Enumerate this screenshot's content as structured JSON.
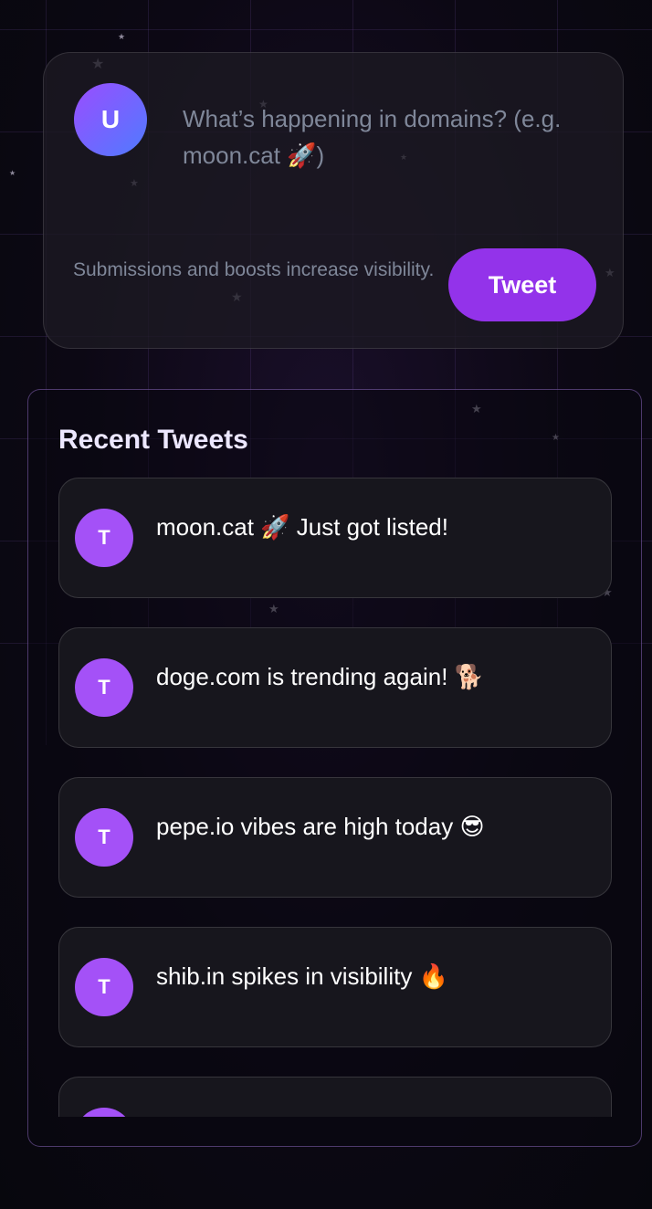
{
  "composer": {
    "avatar_initial": "U",
    "placeholder": "What’s happening in domains? (e.g. moon.cat 🚀)",
    "hint": "Submissions and boosts increase visibility.",
    "tweet_button_label": "Tweet"
  },
  "recent": {
    "title": "Recent Tweets",
    "tweets": [
      {
        "avatar_initial": "T",
        "text": "moon.cat 🚀 Just got listed!"
      },
      {
        "avatar_initial": "T",
        "text": "doge.com is trending again! 🐕"
      },
      {
        "avatar_initial": "T",
        "text": "pepe.io vibes are high today 😎"
      },
      {
        "avatar_initial": "T",
        "text": "shib.in spikes in visibility 🔥"
      },
      {
        "avatar_initial": "T",
        "text": ""
      }
    ]
  },
  "colors": {
    "accent": "#9333ea",
    "avatar_tweet": "#a451f7",
    "avatar_user_gradient": [
      "#9a4dff",
      "#4f7bff"
    ],
    "panel_border": "#9870d2",
    "muted_text": "#7f8799"
  },
  "icons": [
    "star-icon"
  ]
}
